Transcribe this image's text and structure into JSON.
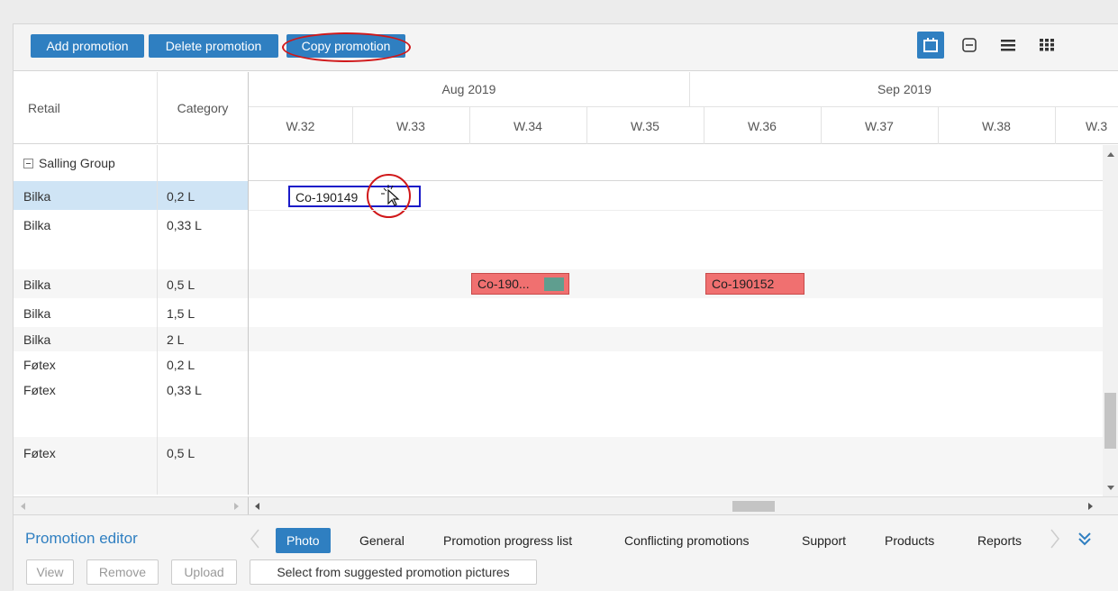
{
  "toolbar": {
    "add_label": "Add promotion",
    "delete_label": "Delete promotion",
    "copy_label": "Copy promotion",
    "views": [
      "calendar-icon",
      "collapse-icon",
      "list-icon",
      "grid-icon"
    ]
  },
  "grid": {
    "col_retail": "Retail",
    "col_category": "Category",
    "months": [
      "Aug 2019",
      "Sep 2019"
    ],
    "weeks": [
      "W.32",
      "W.33",
      "W.34",
      "W.35",
      "W.36",
      "W.37",
      "W.38",
      "W.3"
    ],
    "group_label": "Salling Group",
    "rows": [
      {
        "retail": "Bilka",
        "category": "0,2 L"
      },
      {
        "retail": "Bilka",
        "category": "0,33 L"
      },
      {
        "retail": "Bilka",
        "category": "0,5 L"
      },
      {
        "retail": "Bilka",
        "category": "1,5 L"
      },
      {
        "retail": "Bilka",
        "category": "2 L"
      },
      {
        "retail": "Føtex",
        "category": "0,2 L"
      },
      {
        "retail": "Føtex",
        "category": "0,33 L"
      },
      {
        "retail": "Føtex",
        "category": "0,5 L"
      }
    ],
    "promotions": [
      {
        "label": "Co-190149",
        "state": "selected"
      },
      {
        "label": "Co-190...",
        "state": "conflict"
      },
      {
        "label": "Co-190152",
        "state": "conflict"
      }
    ]
  },
  "editor": {
    "title": "Promotion editor",
    "tabs": [
      "Photo",
      "General",
      "Promotion progress list",
      "Conflicting promotions",
      "Support",
      "Products",
      "Reports"
    ],
    "active_tab": "Photo"
  },
  "actions": {
    "view": "View",
    "remove": "Remove",
    "upload": "Upload",
    "select_pictures": "Select from suggested promotion pictures"
  },
  "colors": {
    "accent": "#2f7fc1",
    "conflict": "#f07070",
    "selected_row": "#cfe4f5",
    "annotation": "#d0181a"
  }
}
